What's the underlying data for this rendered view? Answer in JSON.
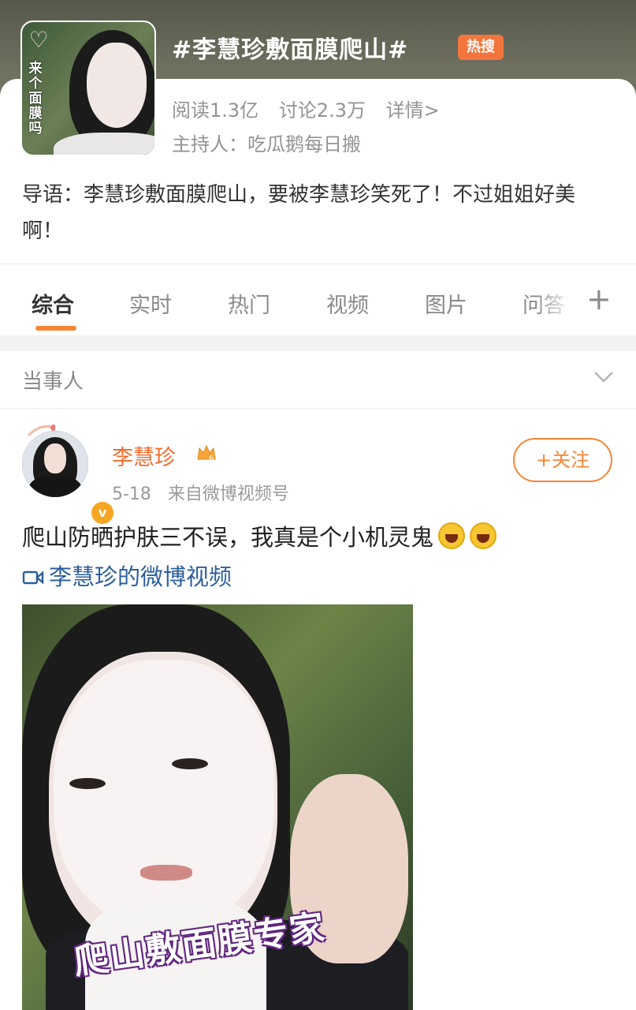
{
  "topic": {
    "title": "#李慧珍敷面膜爬山#",
    "badge": "热搜",
    "reads": "阅读1.3亿",
    "discussions": "讨论2.3万",
    "detail_link": "详情>",
    "host": "主持人：吃瓜鹅每日搬",
    "thumbnail_text": "来个面膜吗",
    "intro": "导语：李慧珍敷面膜爬山，要被李慧珍笑死了！不过姐姐好美啊！"
  },
  "tabs": [
    {
      "label": "综合",
      "active": true
    },
    {
      "label": "实时",
      "active": false
    },
    {
      "label": "热门",
      "active": false
    },
    {
      "label": "视频",
      "active": false
    },
    {
      "label": "图片",
      "active": false
    },
    {
      "label": "问答",
      "active": false
    }
  ],
  "party_section": {
    "label": "当事人"
  },
  "post": {
    "username": "李慧珍",
    "vip_level": "6",
    "date": "5-18",
    "source": "来自微博视频号",
    "follow_label": "+关注",
    "text": "爬山防晒护肤三不误，我真是个小机灵鬼",
    "emojis": [
      "laughing-emoji",
      "laughing-emoji"
    ],
    "video_link": "李慧珍的微博视频",
    "video_caption": "爬山敷面膜专家"
  },
  "colors": {
    "accent": "#f58634",
    "username": "#f06b2b",
    "link": "#2d5f9b",
    "hot_badge": "#f3753c"
  }
}
